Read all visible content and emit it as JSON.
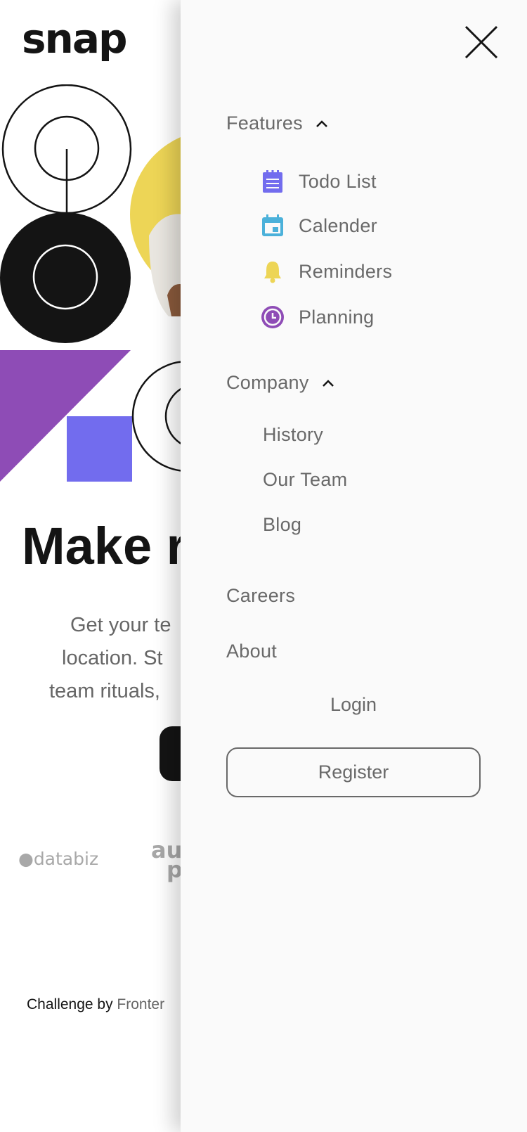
{
  "brand": {
    "logo": "snap"
  },
  "hero": {
    "headline_visible": "Make r",
    "text_lines": [
      "Get your te",
      "location. St",
      "team rituals,"
    ]
  },
  "clients": {
    "databiz": "●databiz",
    "audiophile_visible": "au p"
  },
  "footer": {
    "attribution_prefix": "Challenge by ",
    "attribution_link": "Fronter"
  },
  "menu": {
    "features": {
      "label": "Features",
      "items": [
        {
          "label": "Todo List",
          "icon": "todo-icon",
          "color": "#726CEE"
        },
        {
          "label": "Calender",
          "icon": "calendar-icon",
          "color": "#4BB1DA"
        },
        {
          "label": "Reminders",
          "icon": "bell-icon",
          "color": "#EDD556"
        },
        {
          "label": "Planning",
          "icon": "clock-icon",
          "color": "#8E4CB6"
        }
      ]
    },
    "company": {
      "label": "Company",
      "items": [
        "History",
        "Our Team",
        "Blog"
      ]
    },
    "careers": "Careers",
    "about": "About",
    "login": "Login",
    "register": "Register"
  },
  "colors": {
    "purple": "#8E4CB6",
    "blue": "#726CEE",
    "yellow": "#EDD556",
    "dark": "#141414",
    "text_gray": "#696969"
  }
}
